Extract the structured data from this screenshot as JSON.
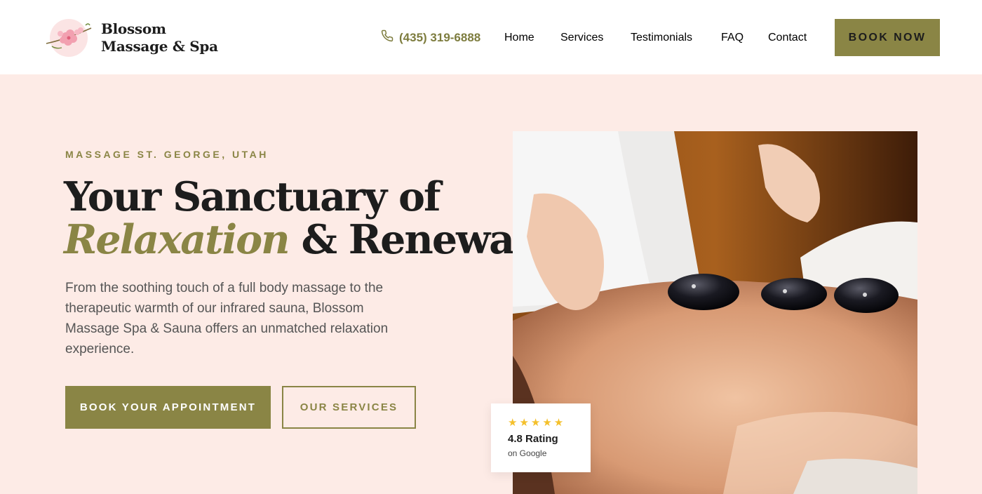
{
  "brand": {
    "line1": "Blossom",
    "line2": "Massage & Spa",
    "logo_icon": "cherry-blossom-icon"
  },
  "header": {
    "phone": "(435) 319-6888",
    "phone_icon": "phone-icon",
    "nav": [
      {
        "label": "Home"
      },
      {
        "label": "Services"
      },
      {
        "label": "Testimonials"
      },
      {
        "label": "FAQ"
      },
      {
        "label": "Contact"
      }
    ],
    "cta_label": "BOOK NOW"
  },
  "hero": {
    "eyebrow": "MASSAGE ST. GEORGE, UTAH",
    "headline_line1": "Your Sanctuary of",
    "headline_accent": "Relaxation",
    "headline_rest": " & Renewal",
    "body": "From the soothing touch of a full body massage to the therapeutic warmth of our infrared sauna, Blossom Massage Spa & Sauna offers an unmatched relaxation experience.",
    "primary_button": "BOOK YOUR APPOINTMENT",
    "secondary_button": "OUR SERVICES"
  },
  "rating": {
    "stars": "★★★★★",
    "value": "4.8 Rating",
    "source": "on Google",
    "star_count": 5
  },
  "colors": {
    "accent": "#8a8545",
    "hero_bg": "#fdebe6",
    "star": "#f4c02c",
    "text": "#1d1d1d"
  }
}
